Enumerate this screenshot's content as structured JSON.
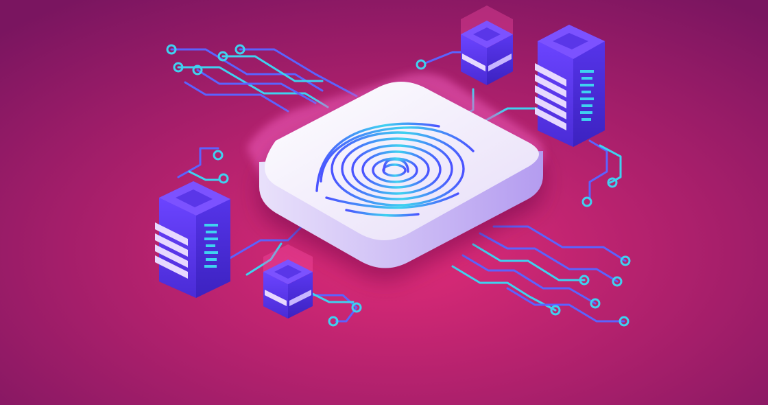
{
  "palette": {
    "background_center": "#e02b78",
    "background_edge": "#7a1560",
    "circuit_line_blue": "#5b63ff",
    "circuit_line_cyan": "#3fd2f0",
    "chip_top": "#f1ecfb",
    "chip_side": "#c9b8f1",
    "chip_glow": "#f25fc0",
    "fingerprint_cyan": "#3fd2f0",
    "fingerprint_blue": "#4b52ff",
    "server_body": "#5a36e8",
    "server_top": "#7c52ff",
    "server_stripe": "#e7d9ff",
    "module_glow": "#ff4fa8"
  },
  "scene": {
    "subject": "fingerprint-chip",
    "icons": [
      "fingerprint-icon",
      "server-rack-icon",
      "server-module-icon",
      "circuit-trace-icon"
    ]
  }
}
